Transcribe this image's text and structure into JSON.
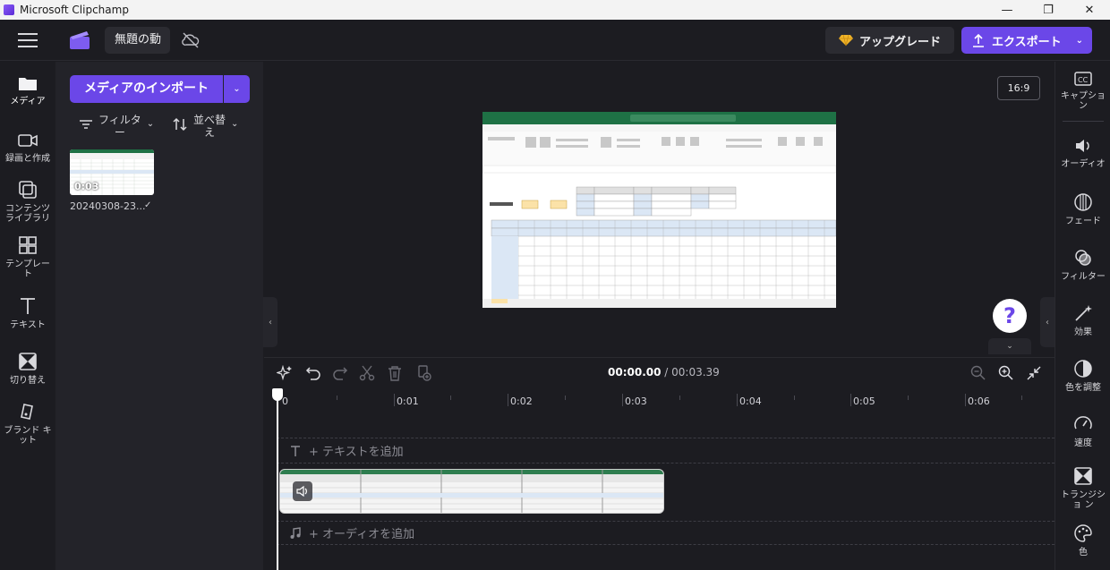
{
  "window": {
    "title": "Microsoft Clipchamp",
    "minimize": "—",
    "restore": "❐",
    "close": "✕"
  },
  "header": {
    "project_name": "無題の動",
    "upgrade_label": "アップグレード",
    "export_label": "エクスポート"
  },
  "leftnav": {
    "items": [
      {
        "label": "メディア",
        "icon": "folder-icon"
      },
      {
        "label": "録画と作成",
        "icon": "camera-icon"
      },
      {
        "label": "コンテンツ ライブラリ",
        "icon": "library-icon"
      },
      {
        "label": "テンプレート",
        "icon": "template-icon"
      },
      {
        "label": "テキスト",
        "icon": "text-icon"
      },
      {
        "label": "切り替え",
        "icon": "transition-icon"
      },
      {
        "label": "ブランド キット",
        "icon": "brand-kit-icon"
      }
    ]
  },
  "media": {
    "import_label": "メディアのインポート",
    "filter_label_1": "フィルタ",
    "filter_label_2": "ー",
    "sort_label_1": "並べ替",
    "sort_label_2": "え",
    "items": [
      {
        "name": "20240308-23...",
        "duration": "0:03"
      }
    ]
  },
  "preview": {
    "aspect_ratio": "16:9",
    "help": "?"
  },
  "rightnav": {
    "items": [
      {
        "label": "キャプショ ン",
        "icon": "captions-icon"
      },
      {
        "label": "オーディオ",
        "icon": "speaker-icon"
      },
      {
        "label": "フェード",
        "icon": "fade-icon"
      },
      {
        "label": "フィルター",
        "icon": "filter-icon"
      },
      {
        "label": "効果",
        "icon": "magic-wand-icon"
      },
      {
        "label": "色を調整",
        "icon": "contrast-icon"
      },
      {
        "label": "速度",
        "icon": "speedometer-icon"
      },
      {
        "label": "トランジショ ン",
        "icon": "transition-icon"
      },
      {
        "label": "色",
        "icon": "palette-icon"
      }
    ]
  },
  "timeline": {
    "current_time": "00:00.00",
    "separator": " / ",
    "total_time": "00:03.39",
    "ruler": [
      "0",
      "0:01",
      "0:02",
      "0:03",
      "0:04",
      "0:05",
      "0:06"
    ],
    "add_text": "+ テキストを追加",
    "add_audio": "+ オーディオを追加"
  },
  "colors": {
    "accent": "#6b47e8",
    "background": "#1c1c21",
    "panel": "#232329"
  }
}
